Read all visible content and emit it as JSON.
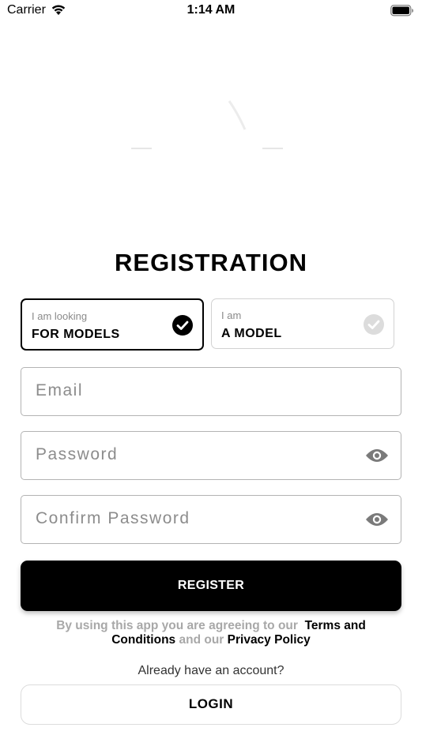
{
  "status_bar": {
    "carrier": "Carrier",
    "time": "1:14 AM"
  },
  "page": {
    "title": "REGISTRATION"
  },
  "roles": [
    {
      "small_label": "I am looking",
      "big_label": "FOR MODELS",
      "selected": true
    },
    {
      "small_label": "I am",
      "big_label": "A MODEL",
      "selected": false
    }
  ],
  "form": {
    "email_placeholder": "Email",
    "password_placeholder": "Password",
    "confirm_password_placeholder": "Confirm Password"
  },
  "actions": {
    "register_label": "REGISTER",
    "login_label": "LOGIN"
  },
  "terms": {
    "prefix": "By using this app you are agreeing to our",
    "terms_link": "Terms and Conditions",
    "middle": "and our",
    "privacy_link": "Privacy Policy"
  },
  "login_prompt": "Already have an account?",
  "icons": {
    "selected_check": "check-circle-icon",
    "unselected_check": "check-circle-icon",
    "password_toggle": "eye-icon",
    "confirm_password_toggle": "eye-icon"
  },
  "colors": {
    "primary": "#000000",
    "placeholder": "#8c8c8c",
    "muted": "#a8a8a8",
    "disabled_check": "#d9d9d9"
  }
}
